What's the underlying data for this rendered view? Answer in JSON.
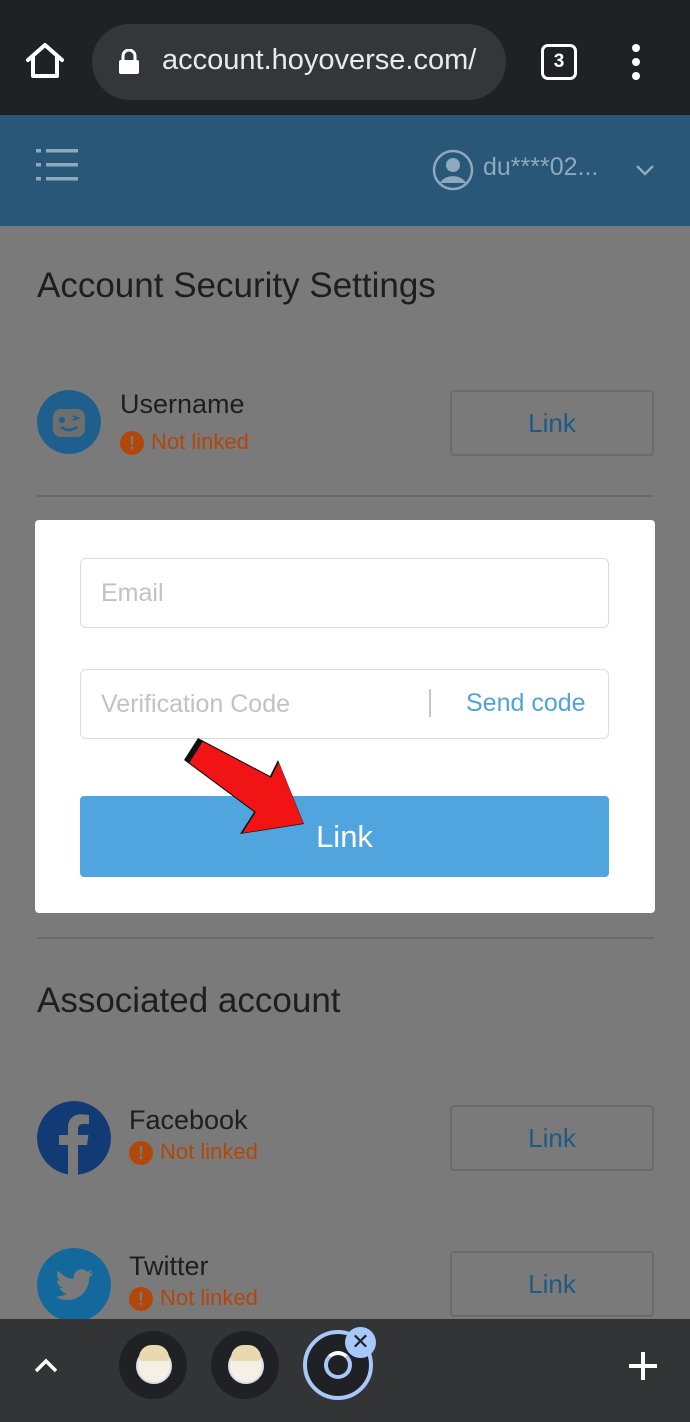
{
  "browser": {
    "url": "account.hoyoverse.com/",
    "tab_count": "3"
  },
  "header": {
    "username": "du****02..."
  },
  "page": {
    "title": "Account Security Settings",
    "username_row": {
      "label": "Username",
      "status": "Not linked",
      "button": "Link"
    },
    "associated_title": "Associated account",
    "accounts": [
      {
        "label": "Facebook",
        "status": "Not linked",
        "button": "Link"
      },
      {
        "label": "Twitter",
        "status": "Not linked",
        "button": "Link"
      }
    ]
  },
  "modal": {
    "email_placeholder": "Email",
    "code_placeholder": "Verification Code",
    "send_code": "Send code",
    "submit": "Link"
  },
  "colors": {
    "header_bg": "#295777",
    "accent": "#50a5de",
    "warning": "#b2470a",
    "overlay_bg": "#7a7a7a"
  },
  "icons": [
    "home-icon",
    "lock-icon",
    "menu-icon",
    "hamburger-icon",
    "user-avatar-icon",
    "chevron-down-icon",
    "bot-face-icon",
    "warning-icon",
    "facebook-icon",
    "twitter-icon",
    "red-arrow-icon",
    "chevron-up-icon",
    "close-icon",
    "plus-icon"
  ]
}
